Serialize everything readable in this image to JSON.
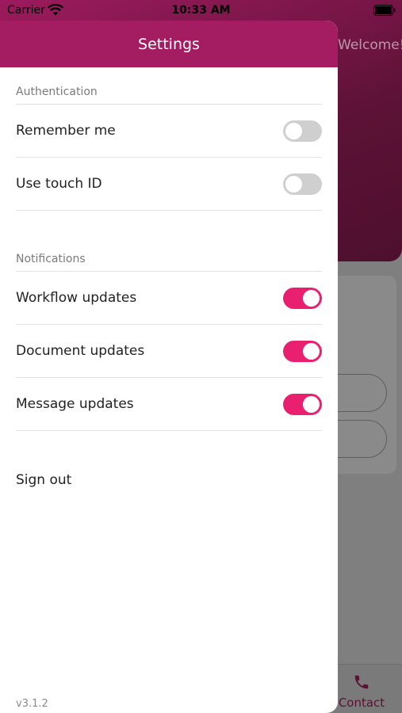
{
  "status_bar": {
    "carrier": "Carrier",
    "time": "10:33 AM",
    "wifi_icon": "wifi-icon",
    "battery_icon": "battery-icon"
  },
  "background": {
    "welcome_text": "Welcome!",
    "contact_label": "Contact",
    "contact_icon": "phone-icon",
    "accent_color": "#9c1b5e"
  },
  "drawer": {
    "title": "Settings",
    "header_color": "#a41c62",
    "sections": [
      {
        "label": "Authentication",
        "items": [
          {
            "label": "Remember me",
            "enabled": false
          },
          {
            "label": "Use touch ID",
            "enabled": false
          }
        ]
      },
      {
        "label": "Notifications",
        "items": [
          {
            "label": "Workflow updates",
            "enabled": true
          },
          {
            "label": "Document updates",
            "enabled": true
          },
          {
            "label": "Message updates",
            "enabled": true
          }
        ]
      }
    ],
    "sign_out_label": "Sign out",
    "version": "v3.1.2",
    "toggle_on_color": "#e8206f",
    "toggle_off_color": "#cfcfcf"
  }
}
